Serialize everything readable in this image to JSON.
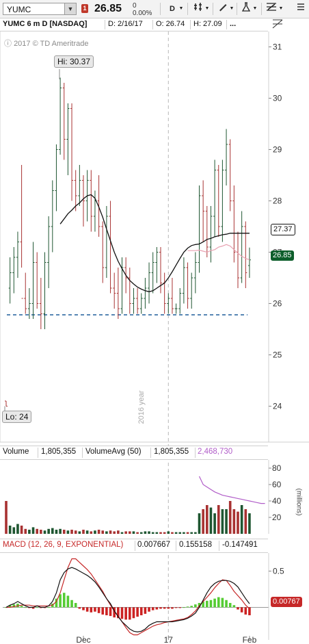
{
  "toolbar": {
    "symbol": "YUMC",
    "flag": "1",
    "last_price": "26.85",
    "net_change": "0",
    "pct_change": "0.00%",
    "period_button": "D",
    "dropdown_icon": "chevron-down-icon",
    "buttons": [
      "studies-icon",
      "drawing-icon",
      "flask-icon",
      "settings-icon",
      "menu-icon"
    ]
  },
  "info_bar": {
    "title": "YUMC 6 m D [NASDAQ]",
    "date": "D: 2/16/17",
    "open": "O: 26.74",
    "high": "H: 27.09",
    "more": "..."
  },
  "watermark": "2017 © TD Ameritrade",
  "separator_label": "2016 year",
  "price_tags": {
    "close": "26.85",
    "close_color": "#0d5e2b",
    "ma": "27.37",
    "ma_color": "#111111"
  },
  "hi_label": "Hi: 30.37",
  "lo_label": "Lo: 24",
  "volume_pane": {
    "label": "Volume",
    "value": "1,805,355",
    "avg_label": "VolumeAvg (50)",
    "avg_value": "1,805,355",
    "avg_value2": "2,468,730",
    "avg_value2_color": "#b05cc8",
    "unit_label": "(millions)"
  },
  "macd_pane": {
    "label": "MACD (12, 26, 9, EXPONENTIAL)",
    "label_color": "#c62828",
    "value": "0.007667",
    "value2": "0.155158",
    "value3": "-0.147491",
    "tag": "0.00767",
    "tag_color": "#c62828"
  },
  "x_axis": [
    "Dec",
    "17",
    "Feb"
  ],
  "colors": {
    "up": "#1e5631",
    "down": "#a83232",
    "ma": "#111111",
    "pink": "#e8a0b0",
    "support": "#1f5f9a",
    "macd": "#111111",
    "signal": "#c62828",
    "hist_up": "#55cc33",
    "hist_down": "#cc2222",
    "vol_avg": "#b05cc8"
  },
  "chart_data": [
    {
      "type": "candlestick",
      "title": "YUMC 6 m D [NASDAQ]",
      "ylim": [
        23.3,
        31.3
      ],
      "y_ticks": [
        24,
        25,
        26,
        27,
        28,
        29,
        30,
        31
      ],
      "x_labels": [
        "Dec",
        "17",
        "Feb"
      ],
      "x_label_index": [
        20,
        42,
        63
      ],
      "separator_index": 42,
      "high_value": 30.37,
      "low_value": 24,
      "support_level": 25.78,
      "ohlc": [
        [
          24.1,
          24.1,
          24.0,
          24.0
        ],
        [
          26.3,
          26.9,
          26.0,
          26.6
        ],
        [
          26.6,
          27.1,
          26.2,
          26.9
        ],
        [
          26.9,
          27.4,
          26.5,
          27.2
        ],
        [
          27.2,
          28.7,
          26.7,
          26.1
        ],
        [
          26.1,
          26.6,
          25.8,
          25.9
        ],
        [
          25.9,
          26.3,
          25.7,
          26.0
        ],
        [
          26.0,
          27.2,
          25.7,
          26.8
        ],
        [
          26.8,
          27.0,
          25.9,
          26.0
        ],
        [
          26.0,
          26.5,
          25.5,
          25.8
        ],
        [
          25.8,
          27.0,
          25.5,
          26.8
        ],
        [
          26.8,
          27.7,
          26.3,
          27.5
        ],
        [
          27.5,
          28.4,
          27.0,
          28.2
        ],
        [
          28.2,
          29.1,
          27.8,
          29.0
        ],
        [
          29.0,
          30.4,
          28.9,
          30.2
        ],
        [
          30.2,
          30.3,
          28.8,
          29.2
        ],
        [
          29.2,
          29.9,
          28.5,
          29.8
        ],
        [
          29.8,
          29.9,
          28.0,
          28.4
        ],
        [
          28.4,
          28.6,
          27.8,
          28.1
        ],
        [
          28.1,
          28.7,
          27.9,
          28.4
        ],
        [
          28.4,
          28.5,
          27.5,
          28.0
        ],
        [
          28.0,
          28.6,
          27.6,
          28.4
        ],
        [
          28.4,
          28.6,
          27.4,
          27.7
        ],
        [
          27.7,
          28.2,
          27.4,
          28.0
        ],
        [
          28.0,
          28.5,
          27.3,
          27.5
        ],
        [
          27.5,
          27.6,
          26.4,
          26.7
        ],
        [
          26.7,
          27.9,
          26.5,
          27.7
        ],
        [
          27.7,
          28.0,
          26.2,
          26.3
        ],
        [
          26.3,
          26.6,
          25.9,
          26.2
        ],
        [
          26.2,
          26.7,
          25.7,
          25.9
        ],
        [
          25.9,
          26.9,
          25.8,
          26.7
        ],
        [
          26.7,
          26.9,
          26.2,
          26.5
        ],
        [
          26.5,
          26.7,
          25.8,
          26.0
        ],
        [
          26.0,
          26.3,
          25.8,
          26.1
        ],
        [
          26.1,
          26.3,
          25.8,
          25.9
        ],
        [
          25.9,
          26.2,
          25.8,
          26.1
        ],
        [
          26.1,
          26.5,
          25.9,
          26.3
        ],
        [
          26.3,
          26.8,
          26.0,
          26.6
        ],
        [
          26.6,
          27.0,
          26.2,
          26.8
        ],
        [
          26.8,
          27.1,
          26.4,
          27.0
        ],
        [
          27.0,
          27.1,
          26.2,
          26.4
        ],
        [
          26.4,
          26.6,
          25.8,
          26.0
        ],
        [
          26.0,
          26.2,
          25.8,
          26.1
        ],
        [
          26.1,
          26.5,
          25.8,
          25.9
        ],
        [
          25.9,
          26.0,
          25.8,
          25.9
        ],
        [
          25.9,
          26.3,
          25.8,
          26.2
        ],
        [
          26.2,
          26.9,
          26.0,
          26.7
        ],
        [
          26.7,
          26.8,
          25.9,
          26.1
        ],
        [
          26.1,
          26.6,
          25.9,
          26.5
        ],
        [
          26.5,
          27.0,
          26.2,
          26.8
        ],
        [
          26.8,
          28.3,
          26.6,
          28.1
        ],
        [
          28.1,
          28.4,
          27.2,
          27.8
        ],
        [
          27.8,
          27.9,
          26.9,
          27.1
        ],
        [
          27.1,
          27.9,
          26.8,
          27.7
        ],
        [
          27.7,
          28.8,
          27.3,
          28.6
        ],
        [
          28.6,
          28.7,
          27.3,
          27.5
        ],
        [
          27.5,
          28.8,
          27.2,
          28.6
        ],
        [
          28.6,
          29.4,
          28.3,
          29.1
        ],
        [
          29.1,
          29.2,
          27.8,
          28.0
        ],
        [
          28.0,
          28.3,
          26.8,
          27.0
        ],
        [
          27.0,
          27.4,
          26.3,
          26.5
        ],
        [
          26.5,
          27.8,
          26.4,
          27.5
        ],
        [
          27.5,
          27.6,
          26.3,
          26.6
        ],
        [
          26.74,
          27.09,
          26.5,
          26.85
        ]
      ],
      "ma_start_index": 14,
      "ma": [
        27.55,
        27.65,
        27.75,
        27.82,
        27.9,
        27.96,
        28.04,
        28.1,
        28.12,
        28.05,
        27.88,
        27.68,
        27.45,
        27.22,
        27.0,
        26.82,
        26.68,
        26.55,
        26.45,
        26.38,
        26.32,
        26.28,
        26.25,
        26.23,
        26.25,
        26.3,
        26.35,
        26.4,
        26.5,
        26.62,
        26.75,
        26.88,
        27.0,
        27.08,
        27.13,
        27.15,
        27.16,
        27.2,
        27.25,
        27.27,
        27.3,
        27.32,
        27.34,
        27.35,
        27.37,
        27.37,
        27.37,
        27.37,
        27.37,
        27.37
      ],
      "ma2_start_index": 47,
      "ma2": [
        27.03,
        27.03,
        27.03,
        27.04,
        27.02,
        27.0,
        27.03,
        27.05,
        27.1,
        27.12,
        27.15,
        27.12,
        27.05,
        26.98,
        26.92,
        26.88,
        26.85
      ]
    },
    {
      "type": "bar",
      "title": "Volume",
      "ylabel": "(millions)",
      "ylim": [
        0,
        90
      ],
      "y_ticks": [
        20,
        40,
        60,
        80
      ],
      "values": [
        40,
        10,
        8,
        12,
        10,
        6,
        5,
        8,
        6,
        5,
        4,
        6,
        7,
        5,
        6,
        5,
        4,
        5,
        4,
        3,
        5,
        4,
        3,
        4,
        5,
        4,
        3,
        4,
        3,
        4,
        2,
        3,
        3,
        3,
        2,
        2,
        3,
        3,
        2,
        2,
        2,
        2,
        3,
        2,
        2,
        2,
        2,
        2,
        2,
        2,
        25,
        30,
        35,
        32,
        25,
        35,
        30,
        30,
        40,
        30,
        27,
        35,
        30,
        25
      ],
      "avg_start_index": 50,
      "avg": [
        70,
        60,
        57,
        54,
        51,
        49,
        47,
        46,
        45,
        44,
        43,
        42,
        41,
        40,
        39,
        38,
        37,
        37
      ]
    },
    {
      "type": "macd",
      "title": "MACD (12, 26, 9, EXPONENTIAL)",
      "ylim": [
        -0.45,
        0.75
      ],
      "y_ticks": [
        0.5
      ],
      "value": 0.007667,
      "macd": [
        0.0,
        0.03,
        0.05,
        0.08,
        0.05,
        0.02,
        0.0,
        0.0,
        0.02,
        0.0,
        0.0,
        0.02,
        0.08,
        0.2,
        0.38,
        0.48,
        0.53,
        0.55,
        0.53,
        0.5,
        0.47,
        0.44,
        0.4,
        0.35,
        0.28,
        0.2,
        0.12,
        0.05,
        -0.05,
        -0.13,
        -0.2,
        -0.25,
        -0.3,
        -0.33,
        -0.34,
        -0.33,
        -0.3,
        -0.25,
        -0.22,
        -0.2,
        -0.2,
        -0.2,
        -0.2,
        -0.2,
        -0.19,
        -0.18,
        -0.17,
        -0.15,
        -0.12,
        -0.08,
        0.0,
        0.1,
        0.2,
        0.28,
        0.33,
        0.36,
        0.37,
        0.37,
        0.36,
        0.33,
        0.28,
        0.2,
        0.12,
        0.05
      ],
      "signal": [
        0.0,
        0.0,
        0.01,
        0.02,
        0.03,
        0.03,
        0.03,
        0.02,
        0.02,
        0.02,
        0.02,
        0.02,
        0.03,
        0.08,
        0.2,
        0.38,
        0.55,
        0.67,
        0.67,
        0.62,
        0.57,
        0.52,
        0.46,
        0.38,
        0.3,
        0.22,
        0.12,
        0.03,
        -0.05,
        -0.12,
        -0.2,
        -0.28,
        -0.35,
        -0.38,
        -0.38,
        -0.35,
        -0.32,
        -0.29,
        -0.26,
        -0.24,
        -0.23,
        -0.21,
        -0.2,
        -0.19,
        -0.18,
        -0.17,
        -0.16,
        -0.14,
        -0.1,
        -0.05,
        0.02,
        0.08,
        0.14,
        0.2,
        0.27,
        0.33,
        0.38,
        0.37,
        0.3,
        0.22,
        0.16,
        0.1,
        0.03,
        -0.02
      ],
      "histogram": [
        0.0,
        0.03,
        0.04,
        0.05,
        0.02,
        0.0,
        -0.01,
        -0.02,
        0.0,
        -0.01,
        -0.01,
        0.0,
        0.05,
        0.12,
        0.18,
        0.2,
        0.16,
        0.1,
        0.06,
        -0.02,
        -0.04,
        -0.06,
        -0.07,
        -0.06,
        -0.08,
        -0.1,
        -0.11,
        -0.12,
        -0.14,
        -0.15,
        -0.16,
        -0.17,
        -0.17,
        -0.15,
        -0.13,
        -0.11,
        -0.09,
        -0.06,
        -0.04,
        -0.03,
        -0.02,
        -0.02,
        -0.02,
        -0.02,
        -0.01,
        -0.01,
        0.0,
        0.01,
        0.02,
        0.04,
        0.06,
        0.08,
        0.09,
        0.1,
        0.12,
        0.14,
        0.13,
        0.1,
        0.06,
        0.03,
        -0.03,
        -0.07,
        -0.1,
        -0.11
      ]
    }
  ]
}
